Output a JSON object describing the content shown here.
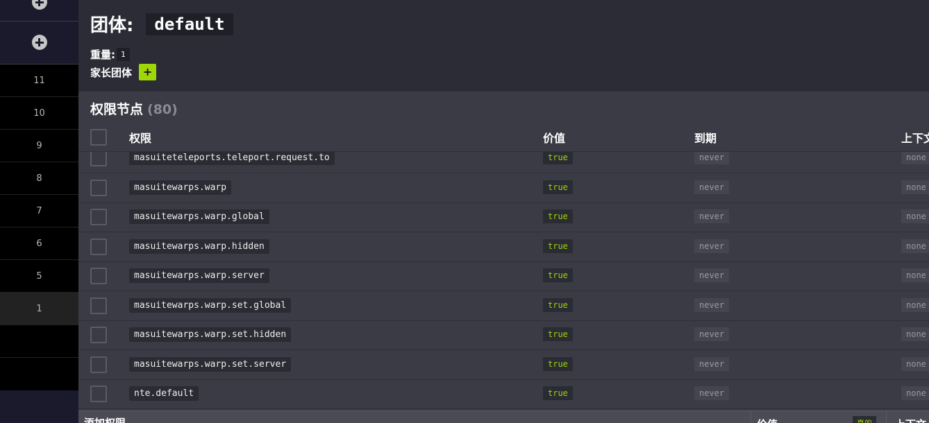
{
  "sidebar": {
    "weights": [
      "11",
      "10",
      "9",
      "8",
      "7",
      "6",
      "5",
      "1"
    ]
  },
  "group": {
    "label": "团体:",
    "name": "default",
    "weight_label": "重量:",
    "weight_value": "1",
    "parent_label": "家长团体",
    "add_parent_label": "+"
  },
  "permissions": {
    "title": "权限节点",
    "count": "(80)",
    "columns": {
      "permission": "权限",
      "value": "价值",
      "expiry": "到期",
      "context": "上下文"
    },
    "rows": [
      {
        "node": "masuiteteleports.teleport.request.to",
        "value": "true",
        "expiry": "never",
        "context": "none"
      },
      {
        "node": "masuitewarps.warp",
        "value": "true",
        "expiry": "never",
        "context": "none"
      },
      {
        "node": "masuitewarps.warp.global",
        "value": "true",
        "expiry": "never",
        "context": "none"
      },
      {
        "node": "masuitewarps.warp.hidden",
        "value": "true",
        "expiry": "never",
        "context": "none"
      },
      {
        "node": "masuitewarps.warp.server",
        "value": "true",
        "expiry": "never",
        "context": "none"
      },
      {
        "node": "masuitewarps.warp.set.global",
        "value": "true",
        "expiry": "never",
        "context": "none"
      },
      {
        "node": "masuitewarps.warp.set.hidden",
        "value": "true",
        "expiry": "never",
        "context": "none"
      },
      {
        "node": "masuitewarps.warp.set.server",
        "value": "true",
        "expiry": "never",
        "context": "none"
      },
      {
        "node": "nte.default",
        "value": "true",
        "expiry": "never",
        "context": "none"
      }
    ]
  },
  "add_bar": {
    "label": "添加权限",
    "value_label": "价值",
    "value_chip": "真的",
    "context_label": "上下文"
  },
  "colors": {
    "accent": "#9fd60a",
    "background": "#2b2c36",
    "panel": "#3a3b45",
    "sidebar": "#000000"
  }
}
